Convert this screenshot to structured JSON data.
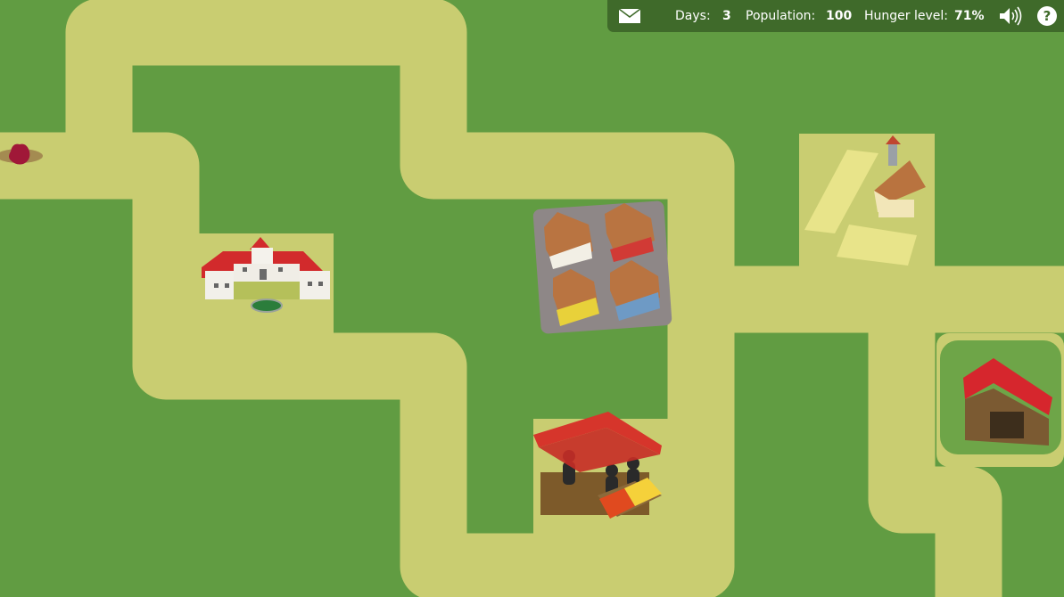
{
  "hud": {
    "mail_icon": "envelope-icon",
    "days_label": "Days:",
    "days_value": "3",
    "population_label": "Population:",
    "population_value": "100",
    "hunger_label": "Hunger level:",
    "hunger_value": "71%",
    "sound_icon": "speaker-icon",
    "help_label": "?"
  },
  "buildings": [
    "town-hall",
    "houses",
    "farm",
    "market",
    "barn"
  ],
  "colors": {
    "grass": "#619c42",
    "path": "#c9cd71",
    "hud_bg": "#3f6a2a",
    "roof_red": "#c8252a",
    "roof_brown": "#b0703d"
  }
}
